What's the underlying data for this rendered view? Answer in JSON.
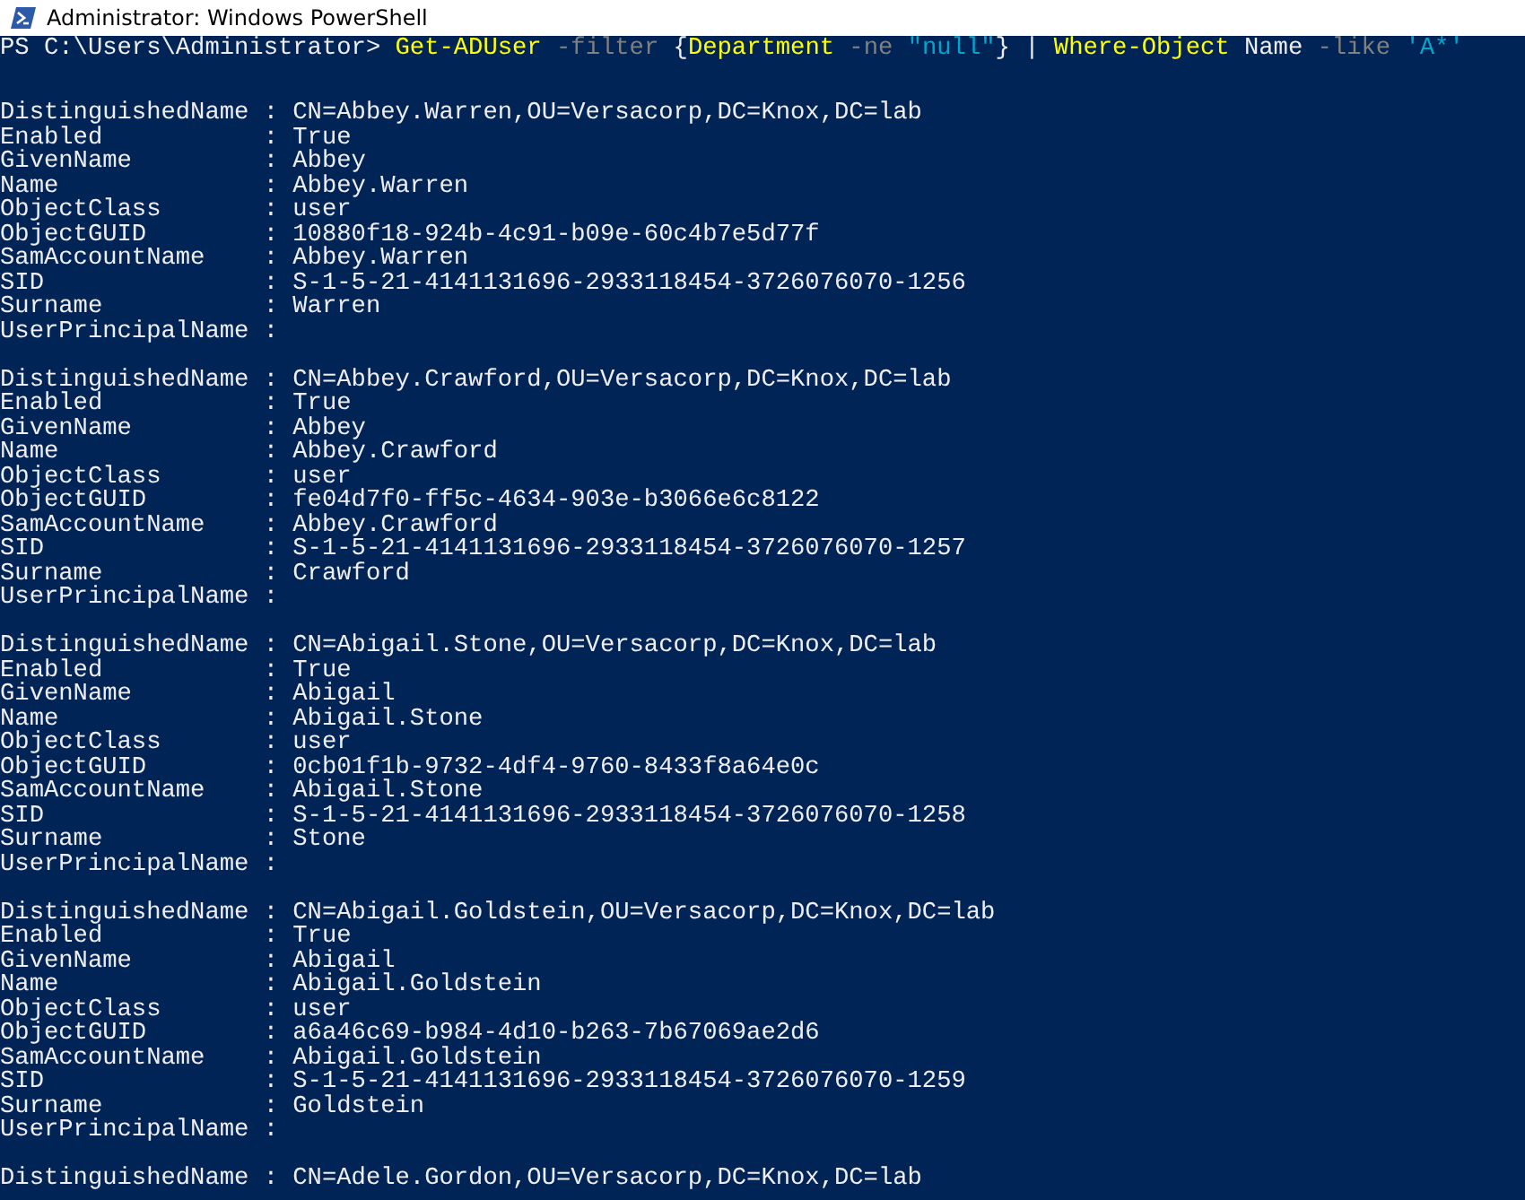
{
  "window": {
    "title": "Administrator: Windows PowerShell"
  },
  "console": {
    "command": [
      {
        "kind": "prompt",
        "text": "PS C:\\Users\\Administrator> "
      },
      {
        "kind": "cmdlet",
        "text": "Get-ADUser"
      },
      {
        "kind": "parameter",
        "text": " -filter"
      },
      {
        "kind": "plain",
        "text": " {"
      },
      {
        "kind": "cmdlet",
        "text": "Department"
      },
      {
        "kind": "parameter",
        "text": " -ne"
      },
      {
        "kind": "string",
        "text": " \"null\""
      },
      {
        "kind": "plain",
        "text": "} | "
      },
      {
        "kind": "cmdlet",
        "text": "Where-Object"
      },
      {
        "kind": "plain",
        "text": " Name"
      },
      {
        "kind": "parameter",
        "text": " -like"
      },
      {
        "kind": "string",
        "text": " 'A*'"
      }
    ],
    "records": [
      {
        "lines": [
          "DistinguishedName : CN=Abbey.Warren,OU=Versacorp,DC=Knox,DC=lab",
          "Enabled           : True",
          "GivenName         : Abbey",
          "Name              : Abbey.Warren",
          "ObjectClass       : user",
          "ObjectGUID        : 10880f18-924b-4c91-b09e-60c4b7e5d77f",
          "SamAccountName    : Abbey.Warren",
          "SID               : S-1-5-21-4141131696-2933118454-3726076070-1256",
          "Surname           : Warren",
          "UserPrincipalName :"
        ]
      },
      {
        "lines": [
          "DistinguishedName : CN=Abbey.Crawford,OU=Versacorp,DC=Knox,DC=lab",
          "Enabled           : True",
          "GivenName         : Abbey",
          "Name              : Abbey.Crawford",
          "ObjectClass       : user",
          "ObjectGUID        : fe04d7f0-ff5c-4634-903e-b3066e6c8122",
          "SamAccountName    : Abbey.Crawford",
          "SID               : S-1-5-21-4141131696-2933118454-3726076070-1257",
          "Surname           : Crawford",
          "UserPrincipalName :"
        ]
      },
      {
        "lines": [
          "DistinguishedName : CN=Abigail.Stone,OU=Versacorp,DC=Knox,DC=lab",
          "Enabled           : True",
          "GivenName         : Abigail",
          "Name              : Abigail.Stone",
          "ObjectClass       : user",
          "ObjectGUID        : 0cb01f1b-9732-4df4-9760-8433f8a64e0c",
          "SamAccountName    : Abigail.Stone",
          "SID               : S-1-5-21-4141131696-2933118454-3726076070-1258",
          "Surname           : Stone",
          "UserPrincipalName :"
        ]
      },
      {
        "lines": [
          "DistinguishedName : CN=Abigail.Goldstein,OU=Versacorp,DC=Knox,DC=lab",
          "Enabled           : True",
          "GivenName         : Abigail",
          "Name              : Abigail.Goldstein",
          "ObjectClass       : user",
          "ObjectGUID        : a6a46c69-b984-4d10-b263-7b67069ae2d6",
          "SamAccountName    : Abigail.Goldstein",
          "SID               : S-1-5-21-4141131696-2933118454-3726076070-1259",
          "Surname           : Goldstein",
          "UserPrincipalName :"
        ]
      },
      {
        "lines": [
          "DistinguishedName : CN=Adele.Gordon,OU=Versacorp,DC=Knox,DC=lab"
        ]
      }
    ]
  }
}
